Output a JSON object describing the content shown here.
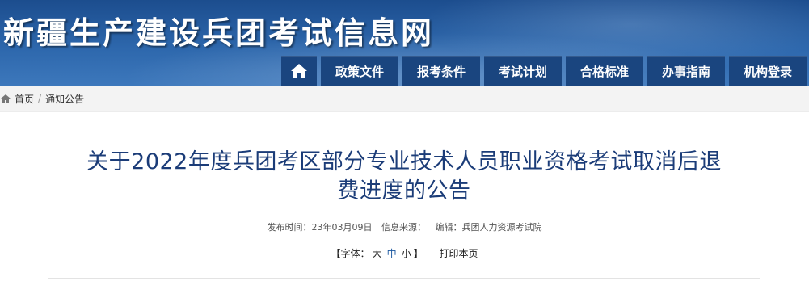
{
  "header": {
    "site_title": "新疆生产建设兵团考试信息网"
  },
  "nav": {
    "home_icon": "home-icon",
    "items": [
      "政策文件",
      "报考条件",
      "考试计划",
      "合格标准",
      "办事指南",
      "机构登录"
    ]
  },
  "breadcrumb": {
    "home": "首页",
    "separator": "/",
    "current": "通知公告"
  },
  "article": {
    "title_line1": "关于2022年度兵团考区部分专业技术人员职业资格考试取消后退",
    "title_line2": "费进度的公告",
    "publish_time": "发布时间：23年03月09日",
    "source": "信息来源：",
    "editor": "编辑：兵团人力资源考试院",
    "font_prefix": "【字体：",
    "font_large": "大",
    "font_medium": "中",
    "font_small": "小",
    "font_suffix": "】",
    "print": "打印本页"
  },
  "colors": {
    "header_blue": "#2d67ac",
    "nav_bg": "#1a457f",
    "title_color": "#1b3c78",
    "active_font": "#1a57a0"
  }
}
